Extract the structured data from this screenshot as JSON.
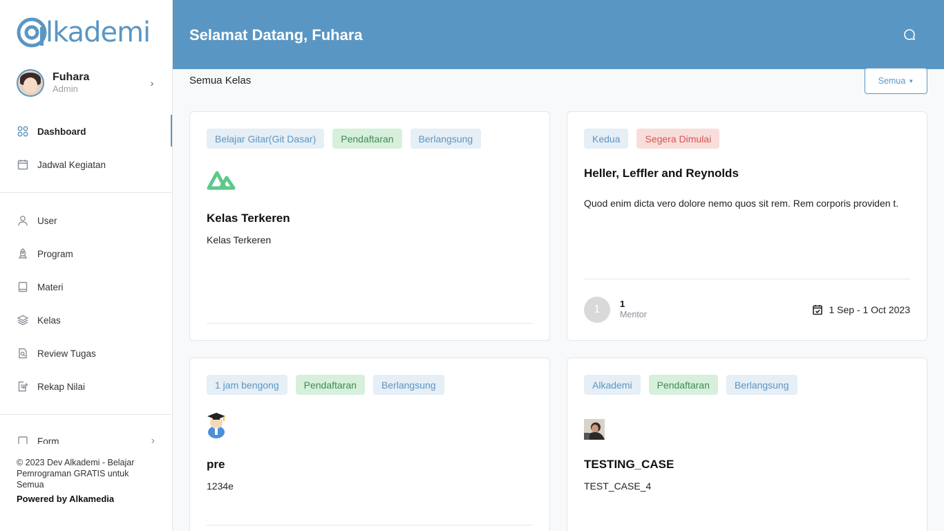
{
  "brand": {
    "logo_text": "lkademi",
    "logo_letter": "A",
    "color": "#5a96c3"
  },
  "profile": {
    "name": "Fuhara",
    "role": "Admin"
  },
  "nav_primary": [
    {
      "label": "Dashboard",
      "icon": "grid-icon",
      "active": true
    },
    {
      "label": "Jadwal Kegiatan",
      "icon": "calendar-icon",
      "active": false
    }
  ],
  "nav_secondary": [
    {
      "label": "User",
      "icon": "user-icon"
    },
    {
      "label": "Program",
      "icon": "rocket-icon"
    },
    {
      "label": "Materi",
      "icon": "book-icon"
    },
    {
      "label": "Kelas",
      "icon": "layers-icon"
    },
    {
      "label": "Review Tugas",
      "icon": "file-search-icon"
    },
    {
      "label": "Rekap Nilai",
      "icon": "edit-note-icon"
    }
  ],
  "nav_partial": {
    "label": "Form",
    "icon": "form-icon"
  },
  "footer": {
    "copyright": "© 2023 Dev Alkademi - Belajar Pemrograman GRATIS untuk Semua",
    "powered": "Powered by Alkamedia"
  },
  "header": {
    "title": "Selamat Datang, Fuhara",
    "chat_icon": "chat-icon"
  },
  "section": {
    "title": "Semua Kelas",
    "filter_label": "Semua"
  },
  "cards": [
    {
      "badges": [
        {
          "label": "Belajar Gitar(Git Dasar)",
          "type": "blue"
        },
        {
          "label": "Pendaftaran",
          "type": "green"
        },
        {
          "label": "Berlangsung",
          "type": "blue"
        }
      ],
      "image": "nuxt-logo",
      "title": "Kelas Terkeren",
      "desc": "Kelas Terkeren"
    },
    {
      "badges": [
        {
          "label": "Kedua",
          "type": "blue"
        },
        {
          "label": "Segera Dimulai",
          "type": "red"
        }
      ],
      "title": "Heller, Leffler and Reynolds",
      "desc": "Quod enim dicta vero dolore nemo quos sit rem. Rem corporis providen t.",
      "mentor_initial": "1",
      "mentor_count": "1",
      "mentor_label": "Mentor",
      "date": "1 Sep - 1 Oct 2023"
    },
    {
      "badges": [
        {
          "label": "1 jam bengong",
          "type": "blue"
        },
        {
          "label": "Pendaftaran",
          "type": "green"
        },
        {
          "label": "Berlangsung",
          "type": "blue"
        }
      ],
      "image": "graduate-icon",
      "title": "pre",
      "desc": "1234e"
    },
    {
      "badges": [
        {
          "label": "Alkademi",
          "type": "blue"
        },
        {
          "label": "Pendaftaran",
          "type": "green"
        },
        {
          "label": "Berlangsung",
          "type": "blue"
        }
      ],
      "image": "photo-thumbnail",
      "title": "TESTING_CASE",
      "desc": "TEST_CASE_4"
    }
  ]
}
